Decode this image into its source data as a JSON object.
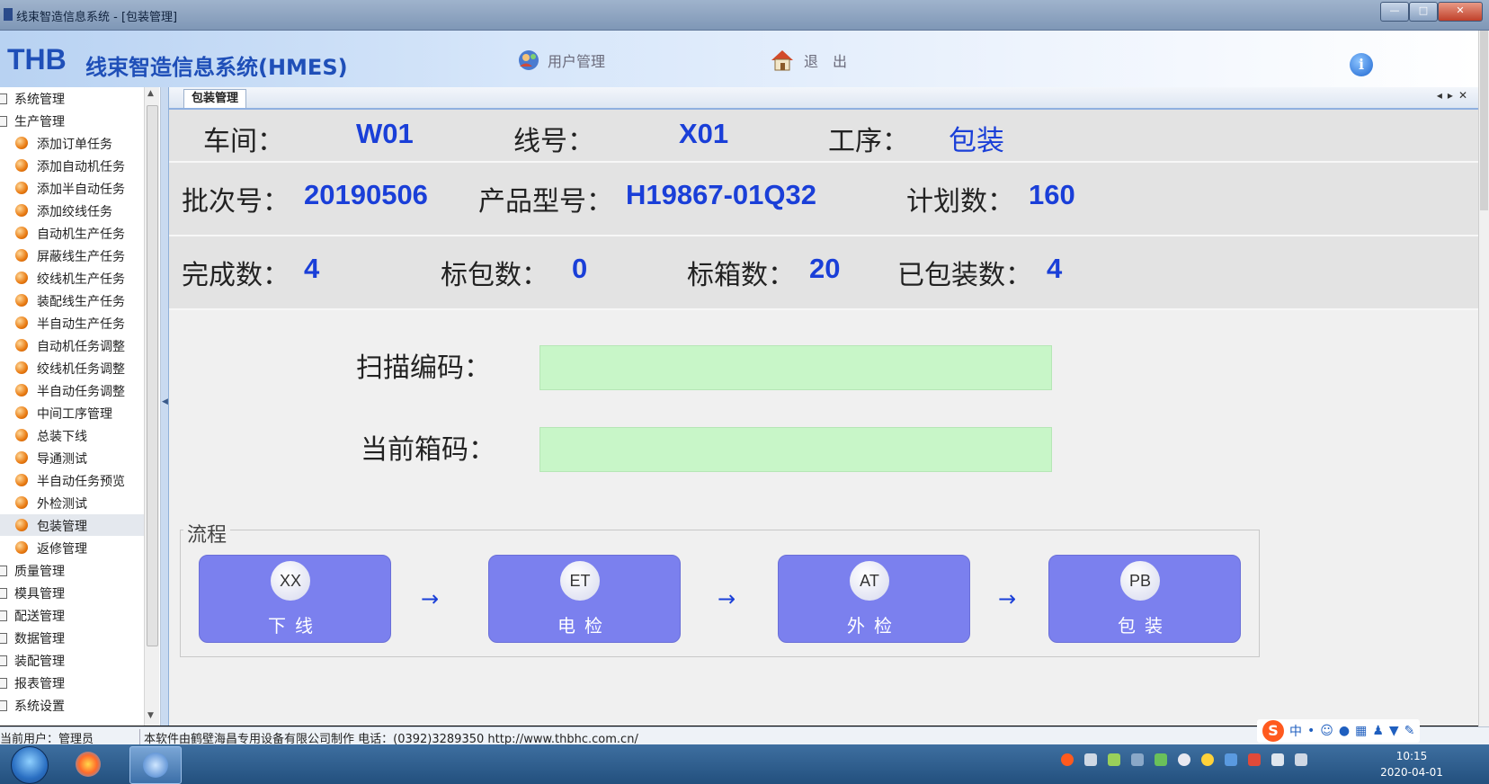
{
  "window": {
    "title": "线束智造信息系统 - [包装管理]",
    "minimize": "—",
    "maximize": "□",
    "close": "✕"
  },
  "header": {
    "brand_short": "THB",
    "brand_name": "线束智造信息系统(HMES)",
    "user_mgmt_label": "用户管理",
    "exit_label": "退　出",
    "info_glyph": "i"
  },
  "sidebar": {
    "items": [
      {
        "label": "系统管理",
        "level": 0
      },
      {
        "label": "生产管理",
        "level": 0
      },
      {
        "label": "添加订单任务",
        "level": 1
      },
      {
        "label": "添加自动机任务",
        "level": 1
      },
      {
        "label": "添加半自动任务",
        "level": 1
      },
      {
        "label": "添加绞线任务",
        "level": 1
      },
      {
        "label": "自动机生产任务",
        "level": 1
      },
      {
        "label": "屏蔽线生产任务",
        "level": 1
      },
      {
        "label": "绞线机生产任务",
        "level": 1
      },
      {
        "label": "装配线生产任务",
        "level": 1
      },
      {
        "label": "半自动生产任务",
        "level": 1
      },
      {
        "label": "自动机任务调整",
        "level": 1
      },
      {
        "label": "绞线机任务调整",
        "level": 1
      },
      {
        "label": "半自动任务调整",
        "level": 1
      },
      {
        "label": "中间工序管理",
        "level": 1
      },
      {
        "label": "总装下线",
        "level": 1
      },
      {
        "label": "导通测试",
        "level": 1
      },
      {
        "label": "半自动任务预览",
        "level": 1
      },
      {
        "label": "外检测试",
        "level": 1
      },
      {
        "label": "包装管理",
        "level": 1,
        "selected": true
      },
      {
        "label": "返修管理",
        "level": 1
      },
      {
        "label": "质量管理",
        "level": 0
      },
      {
        "label": "模具管理",
        "level": 0
      },
      {
        "label": "配送管理",
        "level": 0
      },
      {
        "label": "数据管理",
        "level": 0
      },
      {
        "label": "装配管理",
        "level": 0
      },
      {
        "label": "报表管理",
        "level": 0
      },
      {
        "label": "系统设置",
        "level": 0
      }
    ]
  },
  "tab": {
    "label": "包装管理",
    "controls": "◂▸✕"
  },
  "info": {
    "workshop_label": "车间：",
    "workshop_value": "W01",
    "line_label": "线号：",
    "line_value": "X01",
    "process_label": "工序：",
    "process_value": "包装",
    "batch_label": "批次号：",
    "batch_value": "20190506",
    "model_label": "产品型号：",
    "model_value": "H19867-01Q32",
    "plan_label": "计划数：",
    "plan_value": "160",
    "done_label": "完成数：",
    "done_value": "4",
    "std_pack_label": "标包数：",
    "std_pack_value": "0",
    "std_box_label": "标箱数：",
    "std_box_value": "20",
    "packed_label": "已包装数：",
    "packed_value": "4"
  },
  "form": {
    "scan_label": "扫描编码：",
    "scan_value": "",
    "box_label": "当前箱码：",
    "box_value": ""
  },
  "flow": {
    "legend": "流程",
    "arrow": "→",
    "steps": [
      {
        "code": "XX",
        "name": "下线"
      },
      {
        "code": "ET",
        "name": "电检"
      },
      {
        "code": "AT",
        "name": "外检"
      },
      {
        "code": "PB",
        "name": "包装"
      }
    ]
  },
  "status": {
    "user": "当前用户：管理员",
    "company": "本软件由鹤壁海昌专用设备有限公司制作 电话：(0392)3289350 http://www.thbhc.com.cn/"
  },
  "ime": {
    "logo": "S",
    "mode": "中"
  },
  "taskbar": {
    "time": "10:15",
    "date": "2020-04-01"
  },
  "colors": {
    "accent_blue": "#1a3fd8",
    "input_green": "#c8f6c8",
    "step_purple": "#7b80ee"
  }
}
